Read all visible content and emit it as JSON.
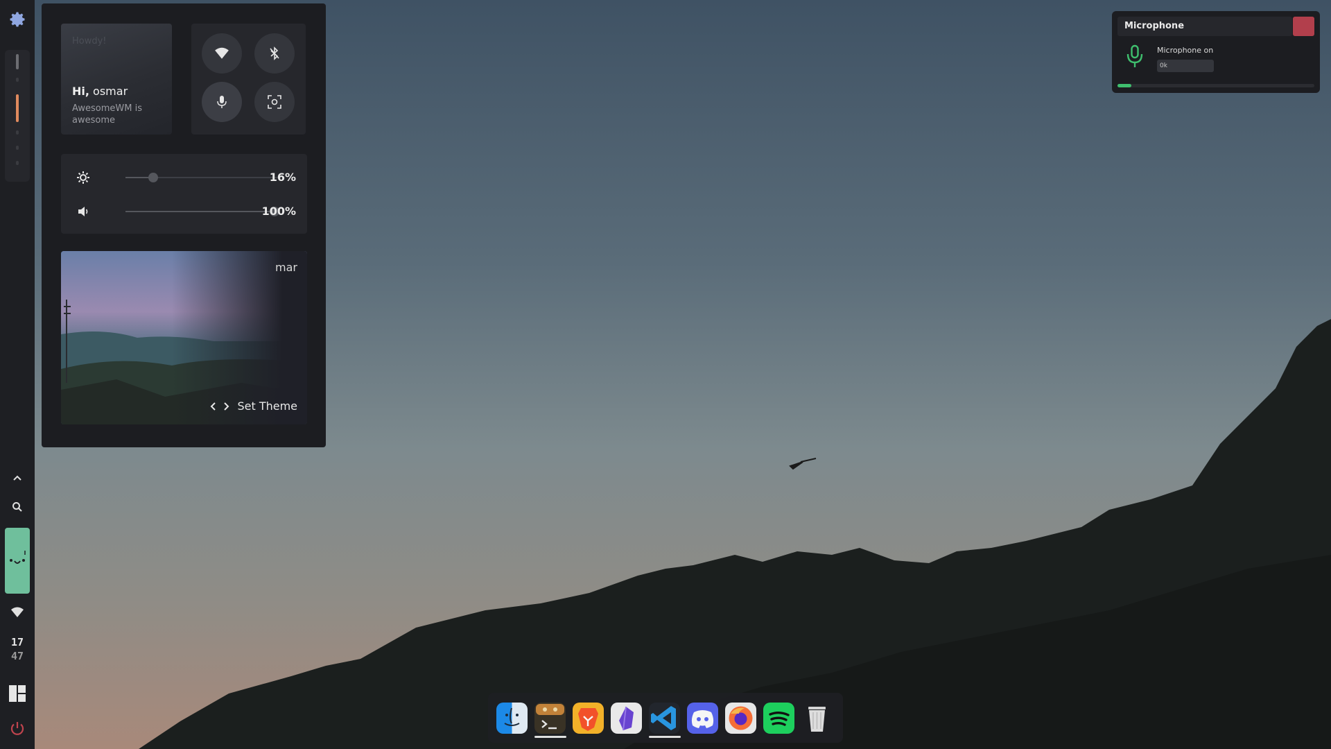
{
  "leftbar": {
    "clock_hours": "17",
    "clock_minutes": "47"
  },
  "greeting": {
    "howdy": "Howdy!",
    "hi": "Hi,",
    "user": "osmar",
    "subtitle": "AwesomeWM is awesome"
  },
  "sliders": {
    "brightness_value": "16%",
    "brightness_level": 0.16,
    "volume_value": "100%",
    "volume_level": 1.0
  },
  "theme": {
    "name": "mar",
    "set_label": "Set Theme"
  },
  "mic_osd": {
    "title": "Microphone",
    "status": "Microphone on",
    "input_value": "0k",
    "level": 0.07
  },
  "dock": {
    "apps": [
      "finder",
      "terminal",
      "brave",
      "obsidian",
      "vscode",
      "discord",
      "firefox",
      "spotify",
      "trash"
    ],
    "running": [
      "terminal",
      "vscode"
    ]
  },
  "colors": {
    "accent_green": "#3fbf6e",
    "close_red": "#b23f4c",
    "panel_bg": "#1c1d21",
    "card_bg": "#26272c"
  }
}
